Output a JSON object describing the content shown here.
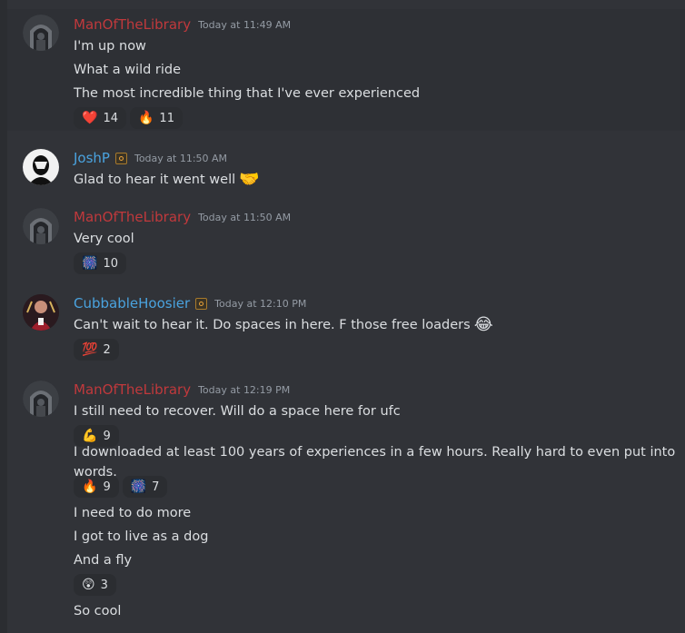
{
  "messages": [
    {
      "user": "ManOfTheLibrary",
      "timestamp": "Today at 11:49 AM",
      "color": "#c0393c",
      "lines": [
        {
          "text": "I'm up now"
        },
        {
          "text": "What a wild ride"
        },
        {
          "text": "The most incredible thing that I've ever experienced",
          "reactions": [
            {
              "emoji": "❤️",
              "icon": "heart-icon",
              "count": "14"
            },
            {
              "emoji": "🔥",
              "icon": "fire-icon",
              "count": "11"
            }
          ]
        }
      ]
    },
    {
      "user": "JoshP",
      "timestamp": "Today at 11:50 AM",
      "color": "#4aa3df",
      "badge": "server-badge-icon",
      "lines": [
        {
          "text": "Glad to hear it went well",
          "inline_emoji": "🤝"
        }
      ]
    },
    {
      "user": "ManOfTheLibrary",
      "timestamp": "Today at 11:50 AM",
      "color": "#c0393c",
      "lines": [
        {
          "text": "Very cool",
          "reactions": [
            {
              "emoji": "🎆",
              "icon": "fireworks-icon",
              "count": "10"
            }
          ]
        }
      ]
    },
    {
      "user": "CubbableHoosier",
      "timestamp": "Today at 12:10 PM",
      "color": "#4aa3df",
      "badge": "server-badge-icon",
      "lines": [
        {
          "text": "Can't wait to hear it. Do spaces in here. F those free loaders",
          "inline_emoji": "😂",
          "reactions": [
            {
              "emoji": "💯",
              "icon": "hundred-icon",
              "count": "2"
            }
          ]
        }
      ]
    },
    {
      "user": "ManOfTheLibrary",
      "timestamp": "Today at 12:19 PM",
      "color": "#c0393c",
      "lines": [
        {
          "text": "I still need to recover. Will do a space here for ufc",
          "reactions": [
            {
              "emoji": "💪",
              "icon": "flexed-biceps-icon",
              "count": "9"
            }
          ]
        },
        {
          "text": "I downloaded at least 100 years of experiences in a few hours. Really hard to even put into words.",
          "reactions": [
            {
              "emoji": "🔥",
              "icon": "fire-icon",
              "count": "9"
            },
            {
              "emoji": "🎆",
              "icon": "fireworks-icon",
              "count": "7"
            }
          ]
        },
        {
          "text": "I need to do more"
        },
        {
          "text": "I got to live as a dog"
        },
        {
          "text": "And a fly",
          "reactions": [
            {
              "emoji": "😲",
              "icon": "astonished-face-icon",
              "count": "3"
            }
          ]
        },
        {
          "text": "So cool"
        }
      ]
    }
  ]
}
